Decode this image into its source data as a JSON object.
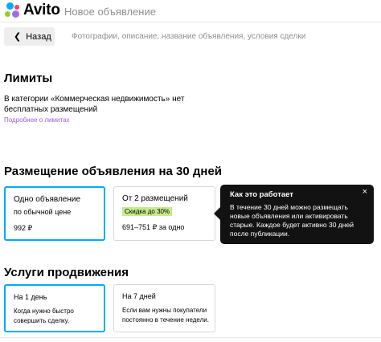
{
  "header": {
    "logo_text": "Avito",
    "page_title": "Новое объявление"
  },
  "nav": {
    "back_label": "Назад",
    "steps": "Фотографии, описание, название объявления, условия сделки"
  },
  "limits": {
    "title": "Лимиты",
    "text": "В категории «Коммерческая недвижимость» нет бесплатных размещений",
    "link": "Подробнее о лимитах"
  },
  "placement": {
    "title": "Размещение объявления на 30 дней",
    "cards": [
      {
        "title": "Одно объявление",
        "subtitle": "по обычной цене",
        "price": "992 ₽"
      },
      {
        "title": "От 2 размещений",
        "badge": "Скидка до 30%",
        "price": "691–751 ₽ за одно"
      }
    ]
  },
  "tooltip": {
    "title": "Как это работает",
    "text": "В течение 30 дней можно размещать новые объявления или активировать старые. Каждое будет активно 30 дней после публикации.",
    "close": "×"
  },
  "promotion": {
    "title": "Услуги продвижения",
    "cards": [
      {
        "title": "На 1 день",
        "description": "Когда нужно быстро совершить сделку."
      },
      {
        "title": "На 7 дней",
        "description": "Если вам нужны покупатели постоянно в течение недели."
      }
    ]
  },
  "colors": {
    "accent": "#00aaff",
    "link": "#9b5fe0",
    "badge": "#c5ec8c",
    "tooltip_bg": "#121212"
  }
}
